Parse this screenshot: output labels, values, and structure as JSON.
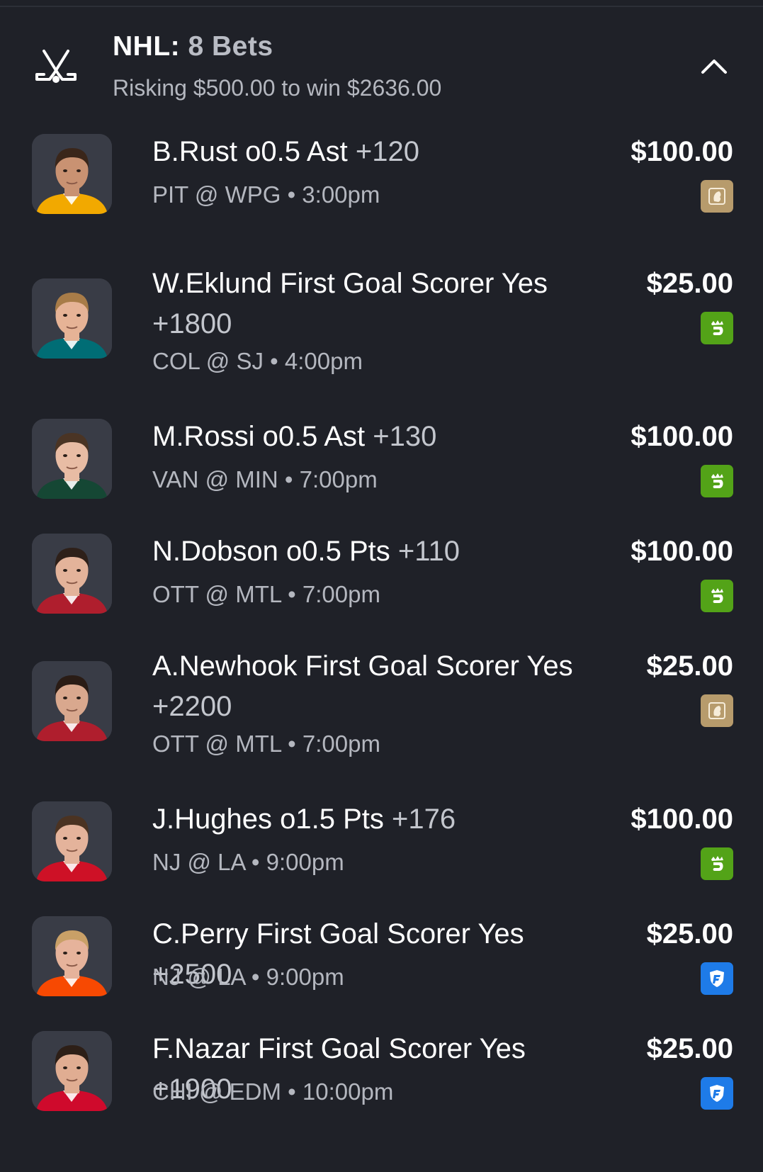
{
  "header": {
    "league": "NHL:",
    "count": "8 Bets",
    "subtitle": "Risking $500.00 to win $2636.00",
    "icon": "hockey-sticks-icon",
    "collapse_icon": "chevron-up-icon"
  },
  "colors": {
    "background": "#1f2128",
    "caesars_badge": "#b79b6c",
    "draftkings_badge": "#53a318",
    "fanduel_badge": "#1e7be8"
  },
  "bets": [
    {
      "player": "B.Rust",
      "market": "o0.5 Ast",
      "odds": "+120",
      "matchup": "PIT @ WPG",
      "time": "3:00pm",
      "amount": "$100.00",
      "book": "caesars-icon",
      "jersey": "#f2a900",
      "skin": "#c99272",
      "hair": "#3a261a"
    },
    {
      "player": "W.Eklund",
      "market": "First Goal Scorer Yes",
      "odds": "+1800",
      "matchup": "COL @ SJ",
      "time": "4:00pm",
      "amount": "$25.00",
      "book": "draftkings-icon",
      "jersey": "#006d75",
      "skin": "#e6b396",
      "hair": "#a87c48"
    },
    {
      "player": "M.Rossi",
      "market": "o0.5 Ast",
      "odds": "+130",
      "matchup": "VAN @ MIN",
      "time": "7:00pm",
      "amount": "$100.00",
      "book": "draftkings-icon",
      "jersey": "#154734",
      "skin": "#e8bca4",
      "hair": "#4a3424"
    },
    {
      "player": "N.Dobson",
      "market": "o0.5 Pts",
      "odds": "+110",
      "matchup": "OTT @ MTL",
      "time": "7:00pm",
      "amount": "$100.00",
      "book": "draftkings-icon",
      "jersey": "#af1e2d",
      "skin": "#e3b39a",
      "hair": "#2e2019"
    },
    {
      "player": "A.Newhook",
      "market": "First Goal Scorer Yes",
      "odds": "+2200",
      "matchup": "OTT @ MTL",
      "time": "7:00pm",
      "amount": "$25.00",
      "book": "caesars-icon",
      "jersey": "#af1e2d",
      "skin": "#d9a88e",
      "hair": "#2a1c15"
    },
    {
      "player": "J.Hughes",
      "market": "o1.5 Pts",
      "odds": "+176",
      "matchup": "NJ @ LA",
      "time": "9:00pm",
      "amount": "$100.00",
      "book": "draftkings-icon",
      "jersey": "#ce1126",
      "skin": "#e4b39b",
      "hair": "#4b3322"
    },
    {
      "player": "C.Perry",
      "market": "First Goal Scorer Yes",
      "odds": "+2500",
      "matchup": "NJ @ LA",
      "time": "9:00pm",
      "amount": "$25.00",
      "book": "fanduel-icon",
      "jersey": "#f74902",
      "skin": "#e6b39b",
      "hair": "#c9a067"
    },
    {
      "player": "F.Nazar",
      "market": "First Goal Scorer Yes",
      "odds": "+1900",
      "matchup": "CHI @ EDM",
      "time": "10:00pm",
      "amount": "$25.00",
      "book": "fanduel-icon",
      "jersey": "#cf0a2c",
      "skin": "#e0ad92",
      "hair": "#2d1f17"
    }
  ]
}
